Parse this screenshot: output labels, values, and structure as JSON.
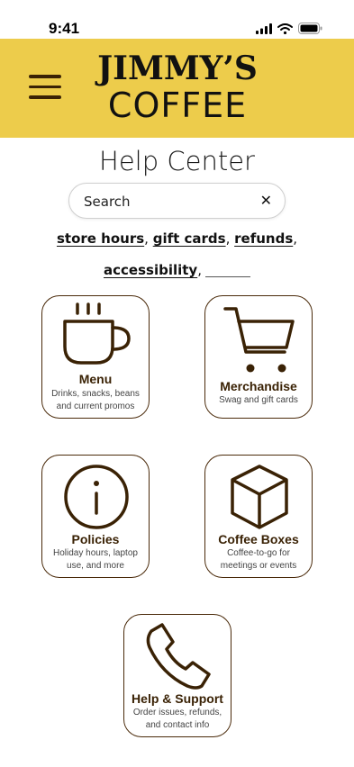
{
  "status_bar": {
    "time": "9:41"
  },
  "header": {
    "brand_line1": "JIMMY’S",
    "brand_line2": "COFFEE",
    "bg_color": "#edcc4b"
  },
  "page": {
    "title": "Help Center"
  },
  "search": {
    "placeholder": "Search",
    "clear_glyph": "✕"
  },
  "quick_links": [
    {
      "label": "store hours"
    },
    {
      "label": "gift cards"
    },
    {
      "label": "refunds"
    },
    {
      "label": "accessibility"
    }
  ],
  "categories": [
    {
      "title": "Menu",
      "description": "Drinks, snacks, beans and current promos",
      "icon": "coffee-cup-icon"
    },
    {
      "title": "Merchandise",
      "description": "Swag and gift cards",
      "icon": "shopping-cart-icon"
    },
    {
      "title": "Policies",
      "description": "Holiday hours, laptop use, and more",
      "icon": "info-icon"
    },
    {
      "title": "Coffee Boxes",
      "description": "Coffee-to-go for meetings or events",
      "icon": "box-icon"
    },
    {
      "title": "Help & Support",
      "description": "Order issues, refunds, and contact info",
      "icon": "phone-icon"
    }
  ],
  "colors": {
    "accent": "#edcc4b",
    "icon_brown": "#3a2205"
  }
}
